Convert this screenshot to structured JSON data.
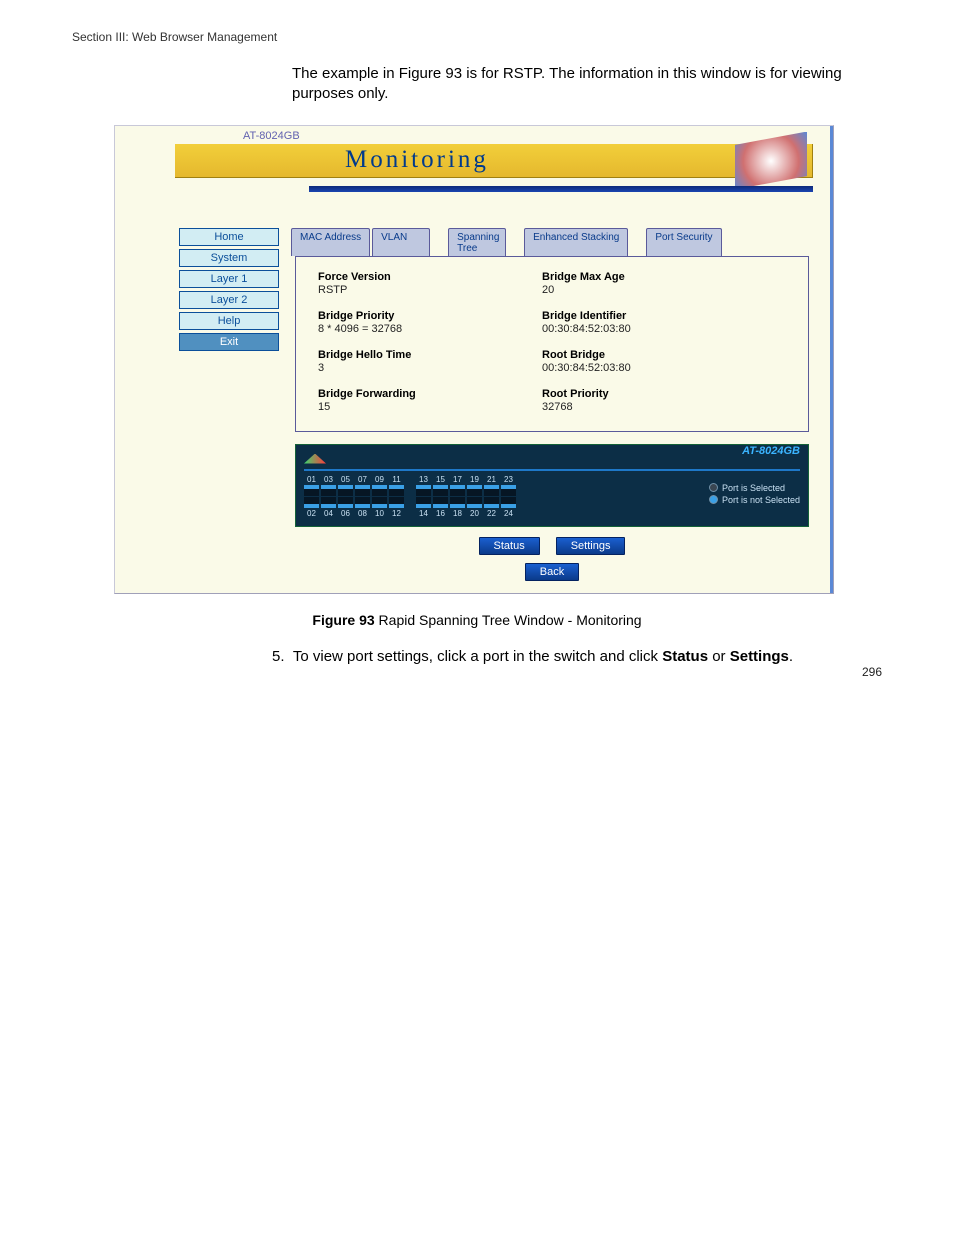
{
  "section_header": "Section III: Web Browser Management",
  "intro": "The example in Figure 93 is for RSTP. The information in this window is for viewing purposes only.",
  "device_label": "AT-8024GB",
  "banner_title": "Monitoring",
  "sidebar": [
    {
      "label": "Home"
    },
    {
      "label": "System"
    },
    {
      "label": "Layer 1"
    },
    {
      "label": "Layer 2"
    },
    {
      "label": "Help"
    },
    {
      "label": "Exit"
    }
  ],
  "tabs": [
    {
      "label": "MAC Address"
    },
    {
      "label": "VLAN"
    },
    {
      "label": "Spanning Tree"
    },
    {
      "label": "Enhanced Stacking"
    },
    {
      "label": "Port Security"
    }
  ],
  "params_left": [
    {
      "lbl": "Force Version",
      "val": "RSTP"
    },
    {
      "lbl": "Bridge Priority",
      "val": "8 * 4096 = 32768"
    },
    {
      "lbl": "Bridge Hello Time",
      "val": "3"
    },
    {
      "lbl": "Bridge Forwarding",
      "val": "15"
    }
  ],
  "params_right": [
    {
      "lbl": "Bridge Max Age",
      "val": "20"
    },
    {
      "lbl": "Bridge Identifier",
      "val": "00:30:84:52:03:80"
    },
    {
      "lbl": "Root Bridge",
      "val": "00:30:84:52:03:80"
    },
    {
      "lbl": "Root Priority",
      "val": "32768"
    }
  ],
  "switch_model": "AT-8024GB",
  "ports_top": [
    "01",
    "03",
    "05",
    "07",
    "09",
    "11",
    "13",
    "15",
    "17",
    "19",
    "21",
    "23"
  ],
  "ports_bot": [
    "02",
    "04",
    "06",
    "08",
    "10",
    "12",
    "14",
    "16",
    "18",
    "20",
    "22",
    "24"
  ],
  "legend": {
    "sel": "Port is Selected",
    "not": "Port is not Selected"
  },
  "buttons": {
    "status": "Status",
    "settings": "Settings",
    "back": "Back"
  },
  "caption_pre": "Figure 93",
  "caption_post": "  Rapid Spanning Tree Window - Monitoring",
  "step_num": "5.",
  "step_pre": "To view port settings, click a port in the switch and click ",
  "step_b1": "Status",
  "step_mid": " or ",
  "step_b2": "Settings",
  "step_end": ".",
  "pagenum": "296"
}
